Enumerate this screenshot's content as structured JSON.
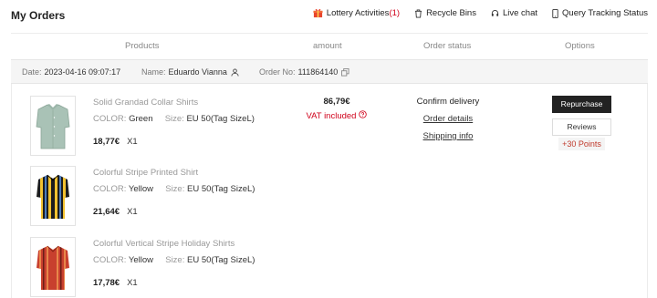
{
  "header": {
    "title": "My Orders",
    "links": [
      {
        "label": "Lottery Activities",
        "count": "(1)",
        "icon": "gift-icon"
      },
      {
        "label": "Recycle Bins",
        "icon": "trash-icon"
      },
      {
        "label": "Live chat",
        "icon": "headset-icon"
      },
      {
        "label": "Query Tracking Status",
        "icon": "phone-icon"
      }
    ]
  },
  "columns": {
    "products": "Products",
    "amount": "amount",
    "status": "Order status",
    "options": "Options"
  },
  "order": {
    "date_label": "Date:",
    "date": "2023-04-16 09:07:17",
    "name_label": "Name:",
    "name": "Eduardo Vianna",
    "order_no_label": "Order No:",
    "order_no": "111864140",
    "amount": "86,79€",
    "vat": "VAT included",
    "status": "Confirm delivery",
    "order_details": "Order details",
    "shipping_info": "Shipping info",
    "repurchase": "Repurchase",
    "reviews": "Reviews",
    "points": "+30 Points"
  },
  "items": [
    {
      "name": "Solid Grandad Collar Shirts",
      "color_label": "COLOR:",
      "color": "Green",
      "size_label": "Size:",
      "size": "EU 50(Tag SizeL)",
      "price": "18,77€",
      "qty": "X1"
    },
    {
      "name": "Colorful Stripe Printed Shirt",
      "color_label": "COLOR:",
      "color": "Yellow",
      "size_label": "Size:",
      "size": "EU 50(Tag SizeL)",
      "price": "21,64€",
      "qty": "X1"
    },
    {
      "name": "Colorful Vertical Stripe Holiday Shirts",
      "color_label": "COLOR:",
      "color": "Yellow",
      "size_label": "Size:",
      "size": "EU 50(Tag SizeL)",
      "price": "17,78€",
      "qty": "X1"
    }
  ],
  "colors": {
    "accent_red": "#d0021b",
    "button_dark": "#222222"
  }
}
